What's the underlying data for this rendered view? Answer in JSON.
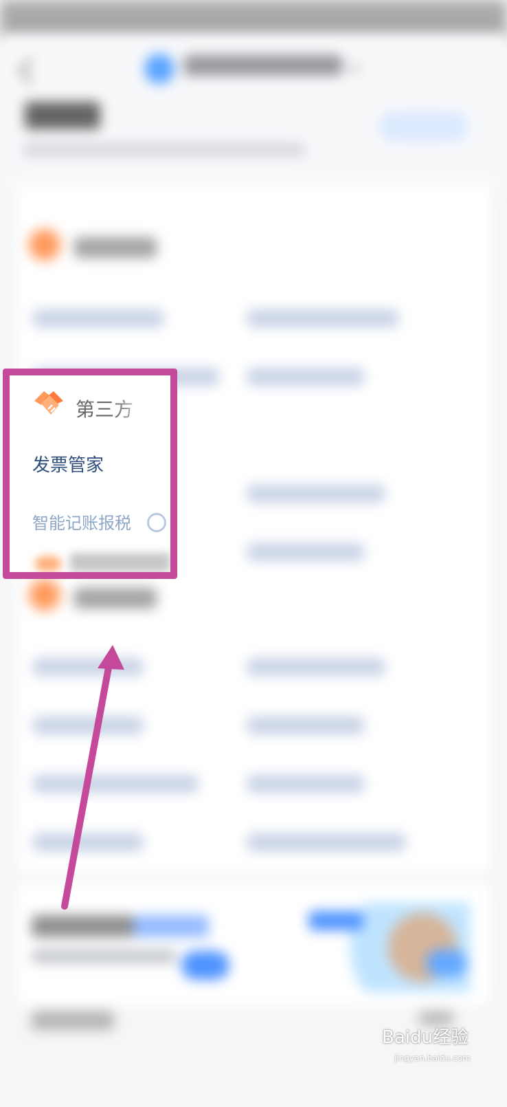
{
  "highlight": {
    "section_title": "第三方",
    "items": [
      {
        "label": "发票管家"
      },
      {
        "label": "智能记账报税"
      }
    ]
  },
  "watermark": {
    "text": "Baidu经验",
    "sub": "jingyan.baidu.com"
  },
  "colors": {
    "highlight_border": "#c4499a",
    "link_primary": "#2e4f7c",
    "link_muted": "#8ea6c8",
    "accent_orange": "#ff7a3d",
    "accent_blue": "#4f93ff"
  },
  "icons": {
    "section_icon": "handshake-icon",
    "pointer": "arrow-pointer"
  }
}
